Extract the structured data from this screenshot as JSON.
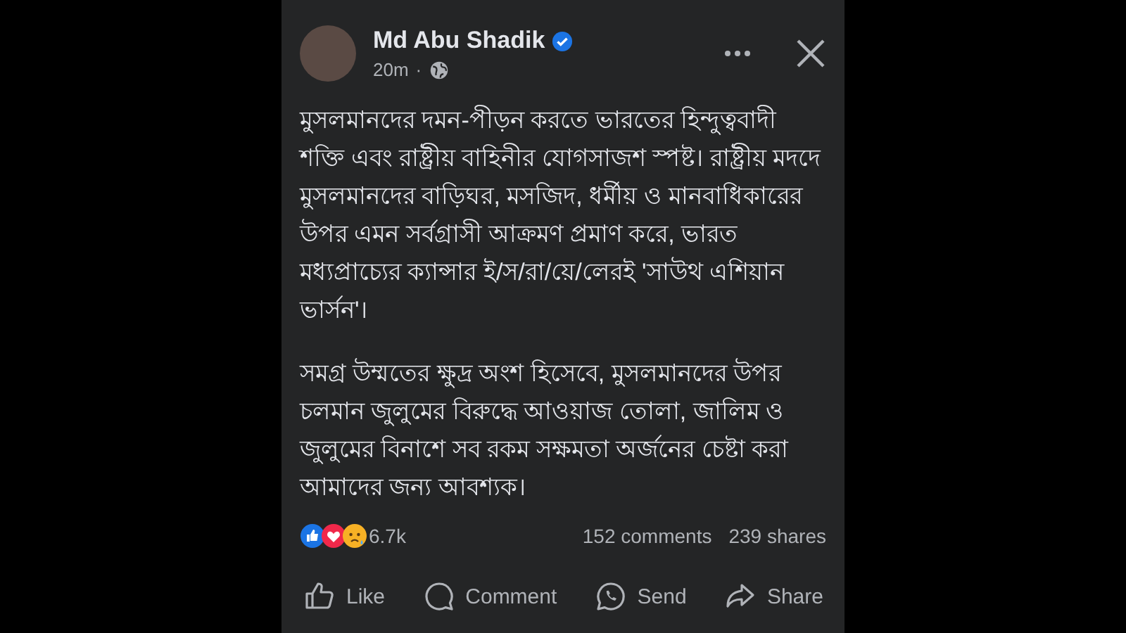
{
  "post": {
    "author": "Md Abu Shadik",
    "verified": true,
    "time": "20m",
    "separator": "·",
    "paragraphs": [
      "মুসলমানদের দমন-পীড়ন করতে ভারতের হিন্দুত্ববাদী শক্তি এবং রাষ্ট্রীয় বাহিনীর যোগসাজশ স্পষ্ট। রাষ্ট্রীয় মদদে মুসলমানদের বাড়িঘর, মসজিদ, ধর্মীয় ও মানবাধিকারের উপর এমন সর্বগ্রাসী আক্রমণ প্রমাণ করে, ভারত মধ্যপ্রাচ্যের ক্যান্সার ই/স/রা/য়ে/লেরই 'সাউথ এশিয়ান ভার্সন'।",
      "সমগ্র উম্মতের ক্ষুদ্র অংশ হিসেবে, মুসলমানদের উপর চলমান জুলুমের বিরুদ্ধে আওয়াজ তোলা, জালিম ও জুলুমের বিনাশে সব রকম সক্ষমতা অর্জনের চেষ্টা করা আমাদের জন্য আবশ্যক।"
    ],
    "reaction_count": "6.7k",
    "comments": "152 comments",
    "shares": "239 shares",
    "actions": [
      {
        "kind": "like",
        "label": "Like"
      },
      {
        "kind": "comment",
        "label": "Comment"
      },
      {
        "kind": "send",
        "label": "Send"
      },
      {
        "kind": "share",
        "label": "Share"
      }
    ]
  }
}
